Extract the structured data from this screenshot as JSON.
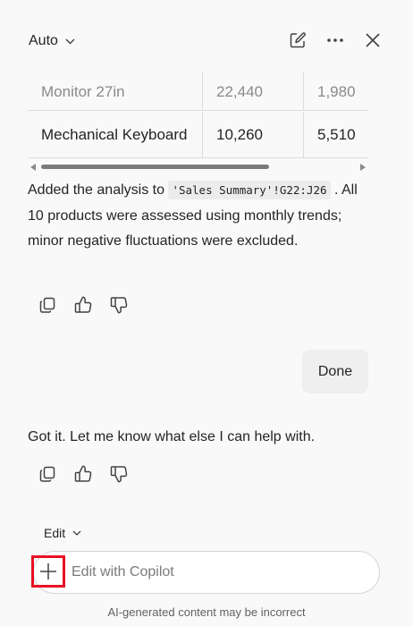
{
  "header": {
    "mode": "Auto",
    "icons": {
      "new_chat": "new-chat-icon",
      "more": "more-icon",
      "close": "close-icon"
    }
  },
  "table": {
    "rows": [
      [
        "Monitor 27in",
        "22,440",
        "1,980"
      ],
      [
        "Mechanical Keyboard",
        "10,260",
        "5,510"
      ]
    ]
  },
  "assistant_1": {
    "text_before": "Added the analysis to ",
    "code": "'Sales Summary'!G22:J26",
    "text_after": " . All 10 products were assessed using monthly trends; minor negative fluctuations were excluded."
  },
  "user_message": "Done",
  "assistant_2": {
    "text": "Got it. Let me know what else I can help with."
  },
  "composer": {
    "mode": "Edit",
    "placeholder": "Edit with Copilot",
    "value": ""
  },
  "disclaimer": "AI-generated content may be incorrect"
}
